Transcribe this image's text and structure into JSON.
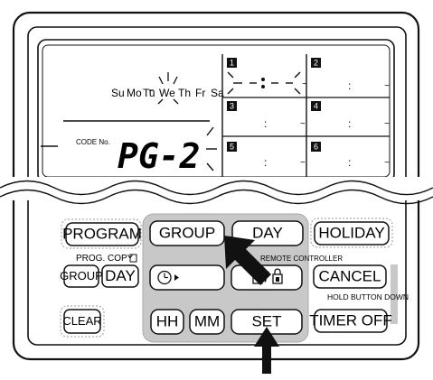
{
  "display": {
    "days": [
      "Su",
      "Mo",
      "Tu",
      "We",
      "Th",
      "Fr",
      "Sa"
    ],
    "code_label": "CODE No.",
    "code_value": "PG-2",
    "program_slots": [
      "1",
      "2",
      "3",
      "4",
      "5",
      "6"
    ],
    "slot_time_sep": ":",
    "slot_range_sep": "~"
  },
  "buttons": {
    "program": "PROGRAM",
    "group": "GROUP",
    "day": "DAY",
    "holiday": "HOLIDAY",
    "prog_copy_label": "PROG. COPY",
    "copy_group": "GROUP",
    "copy_day": "DAY",
    "clock": "",
    "remote_controller_label": "REMOTE CONTROLLER",
    "lock": "/",
    "cancel": "CANCEL",
    "hold_label": "HOLD BUTTON DOWN",
    "clear": "CLEAR",
    "hh": "HH",
    "mm": "MM",
    "set": "SET",
    "timer_off": "TIMER OFF"
  },
  "icons": {
    "arrows": [
      "pointer-arrow-day",
      "pointer-arrow-set"
    ],
    "lock_icons": [
      "unlock-icon",
      "lock-icon"
    ]
  }
}
